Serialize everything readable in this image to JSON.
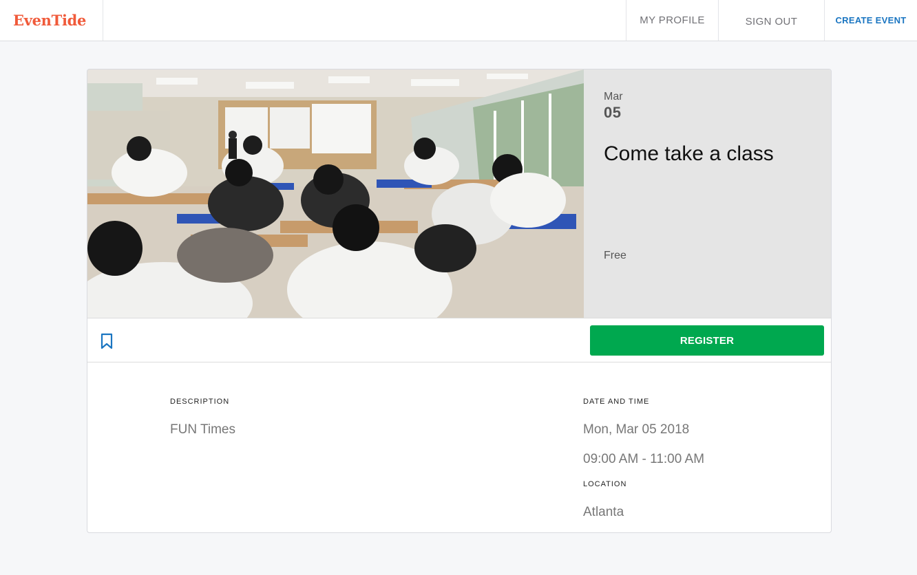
{
  "nav": {
    "brand": "EvenTide",
    "my_profile": "MY PROFILE",
    "sign_out": "SIGN OUT",
    "create_event": "CREATE EVENT"
  },
  "event": {
    "month": "Mar",
    "day": "05",
    "title": "Come take a class",
    "price": "Free",
    "register_label": "REGISTER",
    "description_label": "DESCRIPTION",
    "description": "FUN Times",
    "datetime_label": "DATE AND TIME",
    "date": "Mon, Mar 05 2018",
    "time": "09:00 AM - 11:00 AM",
    "location_label": "LOCATION",
    "location": "Atlanta"
  },
  "colors": {
    "brand": "#f05a3a",
    "create_event": "#1a75c1",
    "register": "#00a84f",
    "bookmark": "#1a75c1"
  },
  "icons": {
    "bookmark": "bookmark-icon"
  }
}
